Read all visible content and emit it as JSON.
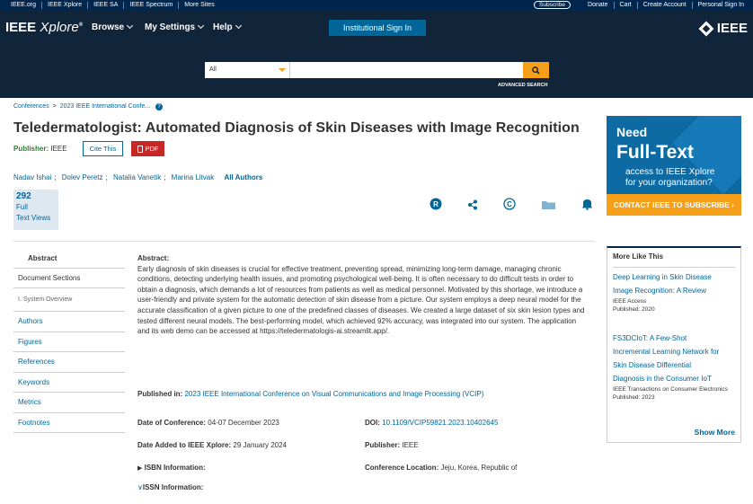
{
  "top_strip": {
    "left_links": [
      "IEEE.org",
      "IEEE Xplore",
      "IEEE SA",
      "IEEE Spectrum",
      "More Sites"
    ],
    "subscribe": "Subscribe",
    "right_links": [
      "Donate",
      "Cart",
      "Create Account",
      "Personal Sign In"
    ]
  },
  "header": {
    "logo_main": "IEEE",
    "logo_italic": "Xplore",
    "logo_reg": "®",
    "nav": [
      "Browse",
      "My Settings",
      "Help"
    ],
    "institutional_signin": "Institutional Sign In",
    "ieee_logo": "IEEE"
  },
  "search": {
    "scope": "All",
    "query": "",
    "advanced": "ADVANCED SEARCH"
  },
  "breadcrumb": {
    "items": [
      "Conferences",
      ">",
      "2023 IEEE International Confe..."
    ]
  },
  "article": {
    "title": "Teledermatologist: Automated Diagnosis of Skin Diseases with Image Recognition",
    "publisher_label": "Publisher:",
    "publisher": "IEEE",
    "cite_btn": "Cite This",
    "pdf_btn": "PDF",
    "authors": [
      "Nadav Ishai",
      "Dolev Peretz",
      "Natalia Vanetik",
      "Marina Litvak"
    ],
    "all_authors": "All Authors",
    "views_num": "292",
    "views_l1": "Full",
    "views_l2": "Text Views"
  },
  "left_nav": {
    "abstract": "Abstract",
    "doc_sections": "Document Sections",
    "system_overview": "I.   System Overview",
    "links": [
      "Authors",
      "Figures",
      "References",
      "Keywords",
      "Metrics",
      "Footnotes"
    ]
  },
  "abstract": {
    "heading": "Abstract:",
    "text": "Early diagnosis of skin diseases is crucial for effective treatment, preventing spread, minimizing long-term damage, managing chronic conditions, detecting underlying health issues, and promoting psychological well-being. It is often necessary to do difficult tests in order to obtain a diagnosis, which demands a lot of resources from patients as well as medical personnel. Motivated by this shortage, we introduce a user-friendly and private system for the automatic detection of skin disease from a picture. Our system employs a deep neural model for the accurate classification of a given picture to one of the predefined classes of diseases. We created a large dataset of six skin lesion types and tested different neural models. The best-performing model, which achieved 92% accuracy, was integrated into our system. The application and its web demo can be accessed at https://teledermatologis-ai.streamlit.app/."
  },
  "meta": {
    "published_in_label": "Published in:",
    "published_in": "2023 IEEE International Conference on Visual Communications and Image Processing (VCIP)",
    "date_conf_label": "Date of Conference:",
    "date_conf": "04-07 December 2023",
    "doi_label": "DOI:",
    "doi": "10.1109/VCIP59821.2023.10402645",
    "date_added_label": "Date Added to IEEE Xplore:",
    "date_added": "29 January 2024",
    "publisher_label": "Publisher:",
    "publisher": "IEEE",
    "isbn": "ISBN Information:",
    "conf_loc_label": "Conference Location:",
    "conf_loc": "Jeju, Korea, Republic of",
    "issn": "ISSN Information:"
  },
  "ad": {
    "need": "Need",
    "full_text": "Full-Text",
    "sub1": "access to IEEE Xplore",
    "sub2": "for your organization?",
    "cta": "CONTACT IEEE TO SUBSCRIBE ›"
  },
  "more_like_this": {
    "heading": "More Like This",
    "articles": [
      {
        "title_l1": "Deep Learning in Skin Disease",
        "title_l2": "Image Recognition: A Review",
        "src": "IEEE Access",
        "pub": "Published: 2020"
      },
      {
        "title_l1": "FS3DCIoT: A Few-Shot",
        "title_l2": "Incremental Learning Network for",
        "title_l3": "Skin Disease Differential",
        "title_l4": "Diagnosis in the Consumer IoT",
        "src": "IEEE Transactions on Consumer Electronics",
        "pub": "Published: 2023"
      }
    ],
    "show_more": "Show More"
  },
  "colors": {
    "header_bg": "#10243a",
    "link": "#006699",
    "accent_orange": "#f6a01a",
    "pdf_red": "#c62828"
  }
}
